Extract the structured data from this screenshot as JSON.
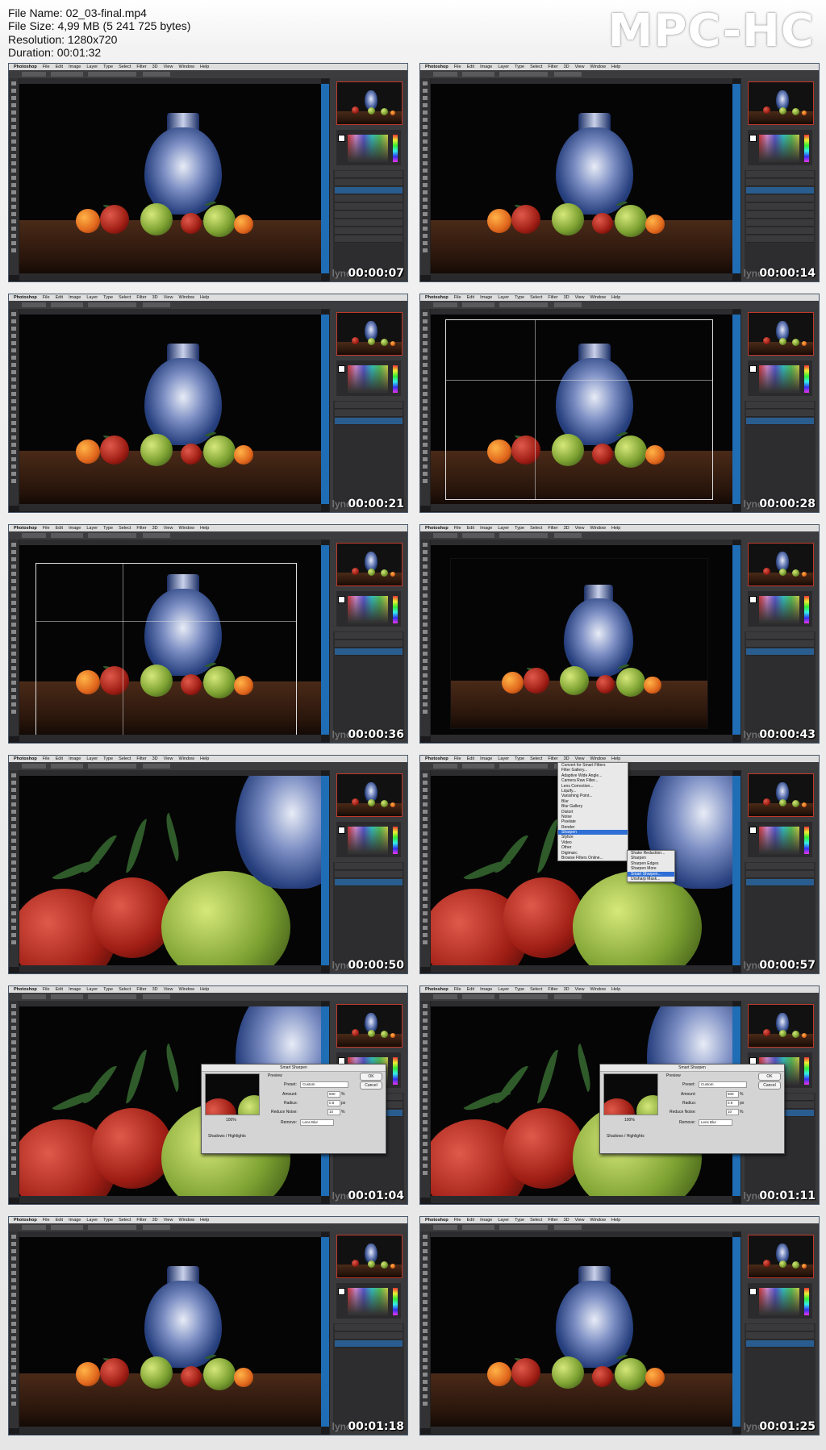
{
  "info": {
    "file_name": "File Name: 02_03-final.mp4",
    "file_size": "File Size: 4,99 MB (5 241 725 bytes)",
    "resolution": "Resolution: 1280x720",
    "duration": "Duration: 00:01:32"
  },
  "brand": "MPC-HC",
  "app": {
    "menu": [
      "Photoshop",
      "File",
      "Edit",
      "Image",
      "Layer",
      "Type",
      "Select",
      "Filter",
      "3D",
      "View",
      "Window",
      "Help"
    ]
  },
  "watermark": "lynda",
  "frames": [
    {
      "timestamp": "00:00:07",
      "scene": "full"
    },
    {
      "timestamp": "00:00:14",
      "scene": "full"
    },
    {
      "timestamp": "00:00:21",
      "scene": "full"
    },
    {
      "timestamp": "00:00:28",
      "scene": "crop-wide"
    },
    {
      "timestamp": "00:00:36",
      "scene": "crop-tight"
    },
    {
      "timestamp": "00:00:43",
      "scene": "cropped"
    },
    {
      "timestamp": "00:00:50",
      "scene": "zoom"
    },
    {
      "timestamp": "00:00:57",
      "scene": "zoom-menu"
    },
    {
      "timestamp": "00:01:04",
      "scene": "zoom-dialog"
    },
    {
      "timestamp": "00:01:11",
      "scene": "zoom-dialog"
    },
    {
      "timestamp": "00:01:18",
      "scene": "full"
    },
    {
      "timestamp": "00:01:25",
      "scene": "full"
    }
  ],
  "filter_menu": {
    "items": [
      "Convert for Smart Filters",
      "Filter Gallery...",
      "Adaptive Wide Angle...",
      "Camera Raw Filter...",
      "Lens Correction...",
      "Liquify...",
      "Vanishing Point...",
      "Blur",
      "Blur Gallery",
      "Distort",
      "Noise",
      "Pixelate",
      "Render",
      "Sharpen",
      "Stylize",
      "Video",
      "Other",
      "Digimarc",
      "Browse Filters Online..."
    ],
    "submenu": [
      "Shake Reduction...",
      "Sharpen",
      "Sharpen Edges",
      "Sharpen More",
      "Smart Sharpen...",
      "Unsharp Mask..."
    ]
  },
  "smart_sharpen": {
    "title": "Smart Sharpen",
    "preview_label": "Preview",
    "ok": "OK",
    "cancel": "Cancel",
    "preset_label": "Preset:",
    "preset_value": "Custom",
    "amount_label": "Amount:",
    "amount_value": "500",
    "amount_unit": "%",
    "radius_label": "Radius:",
    "radius_value": "0.9",
    "radius_unit": "px",
    "noise_label": "Reduce Noise:",
    "noise_value": "10",
    "noise_unit": "%",
    "remove_label": "Remove:",
    "remove_value": "Lens Blur",
    "zoom": "100%",
    "shadows": "Shadows / Highlights"
  }
}
